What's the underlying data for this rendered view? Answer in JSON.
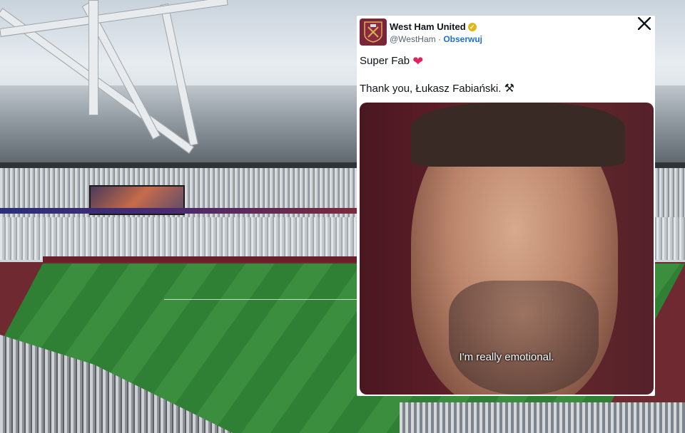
{
  "tweet": {
    "display_name": "West Ham United",
    "handle": "@WestHam",
    "separator": "·",
    "follow_label": "Obserwuj",
    "text_line1": "Super Fab",
    "text_line2": "Thank you, Łukasz Fabiański.",
    "heart_emoji": "❤",
    "hammers_emoji": "⚒",
    "close_icon": "close-icon",
    "media": {
      "subtitle": "I'm really emotional."
    }
  },
  "colors": {
    "accent_link": "#1d6fd0",
    "club_claret": "#7a263a",
    "heart": "#e0245e",
    "verified_badge": "#e2b719"
  }
}
